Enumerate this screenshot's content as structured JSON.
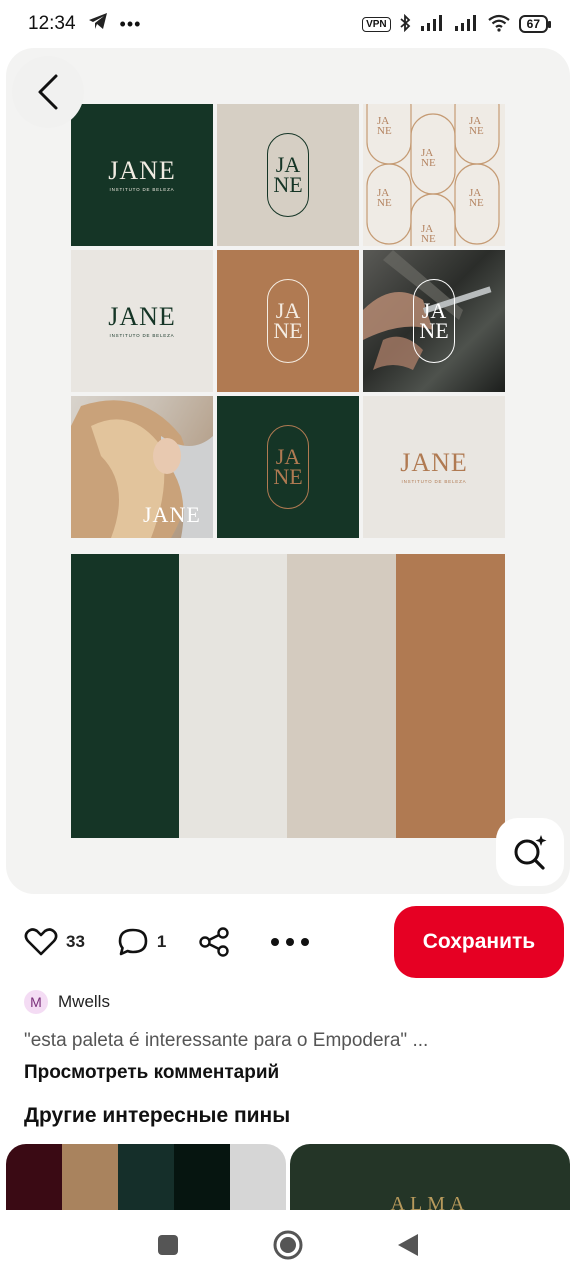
{
  "status": {
    "time": "12:34",
    "vpn": "VPN",
    "battery": "67"
  },
  "pin": {
    "brand": "JANE",
    "brand_tagline": "INSTITUTO DE BELEZA",
    "monogram_top": "JA",
    "monogram_bottom": "NE",
    "palette": [
      "#153526",
      "#e6e4df",
      "#d4cbbf",
      "#b07a52"
    ]
  },
  "actions": {
    "likes": "33",
    "comments": "1",
    "save_label": "Сохранить"
  },
  "author": {
    "initial": "M",
    "name": "Mwells"
  },
  "description": "\"esta paleta é interessante para o Empodera\" ...",
  "view_comments": "Просмотреть комментарий",
  "more_pins_title": "Другие интересные пины",
  "recommendations": {
    "pin1_colors": [
      "#3a0a14",
      "#a9835e",
      "#152f2a",
      "#061510",
      "#d6d6d6"
    ],
    "pin2_text": "ALMA"
  },
  "colors": {
    "accent": "#e60023",
    "dark_green": "#153526",
    "tan": "#b07a52"
  }
}
